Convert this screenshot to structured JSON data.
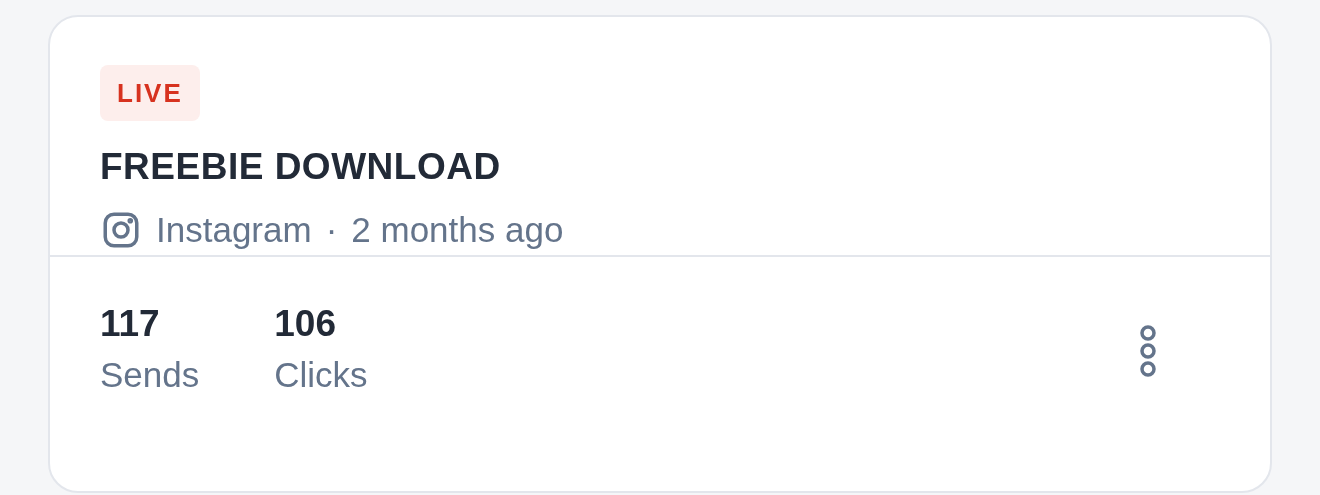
{
  "card": {
    "status": "LIVE",
    "title": "FREEBIE DOWNLOAD",
    "source": "Instagram",
    "separator": "·",
    "time": "2 months ago",
    "stats": [
      {
        "value": "117",
        "label": "Sends"
      },
      {
        "value": "106",
        "label": "Clicks"
      }
    ]
  }
}
